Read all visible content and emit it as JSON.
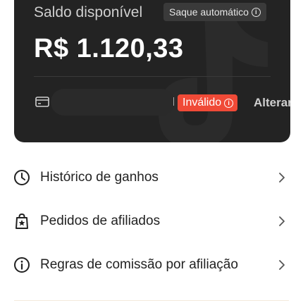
{
  "balance": {
    "label": "Saldo disponível",
    "auto_withdraw_badge": "Saque automático",
    "amount": "R$ 1.120,33"
  },
  "account": {
    "status_badge": "Inválido",
    "change_label": "Alterar"
  },
  "menu": [
    {
      "label": "Histórico de ganhos",
      "icon": "clock-icon"
    },
    {
      "label": "Pedidos de afiliados",
      "icon": "shopping-bag-star-icon"
    },
    {
      "label": "Regras de comissão por afiliação",
      "icon": "info-icon"
    }
  ],
  "colors": {
    "card_bg": "#232323",
    "invalid_badge": "#f04a37",
    "text": "#222222"
  }
}
